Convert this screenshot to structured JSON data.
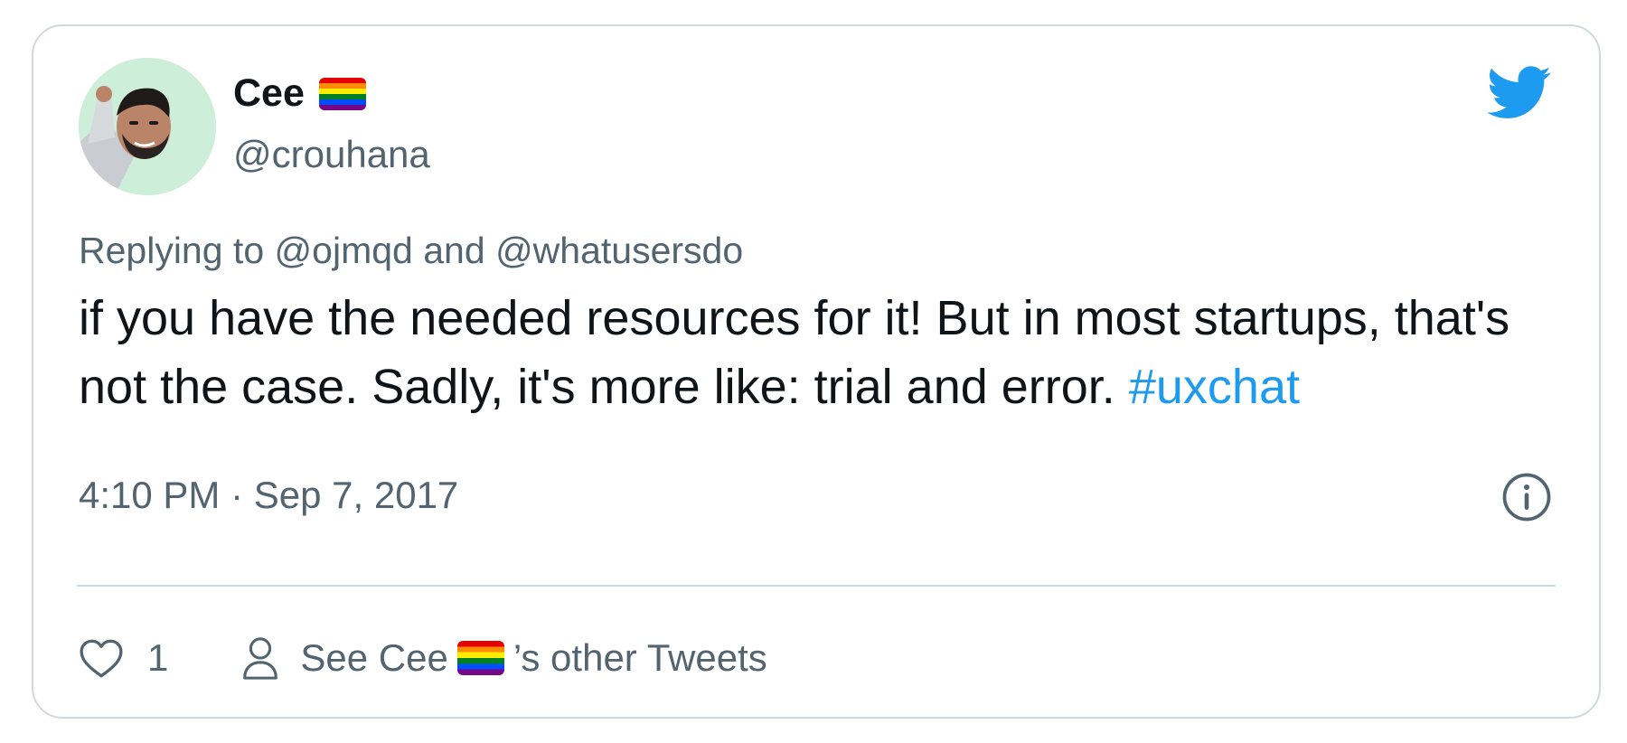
{
  "author": {
    "display_name": "Cee",
    "handle": "@crouhana"
  },
  "reply": {
    "prefix": "Replying to",
    "mention1": "@ojmqd",
    "joiner": "and",
    "mention2": "@whatusersdo"
  },
  "tweet": {
    "text": "if you have the needed resources for it! But in most startups, that's not the case. Sadly, it's more like: trial and error.",
    "hashtag": "#uxchat",
    "time": "4:10 PM",
    "separator": "·",
    "date": "Sep 7, 2017"
  },
  "actions": {
    "like_count": "1",
    "see_prefix": "See Cee",
    "see_suffix": "’s other Tweets"
  },
  "icons": {
    "logo": "twitter-bird-icon",
    "info": "info-icon",
    "like": "heart-icon",
    "profile": "person-icon",
    "flag": "rainbow-flag-emoji"
  },
  "colors": {
    "brand": "#1d9bf0",
    "secondary_text": "#536471",
    "primary_text": "#0f1419",
    "border": "#cfd9de"
  }
}
